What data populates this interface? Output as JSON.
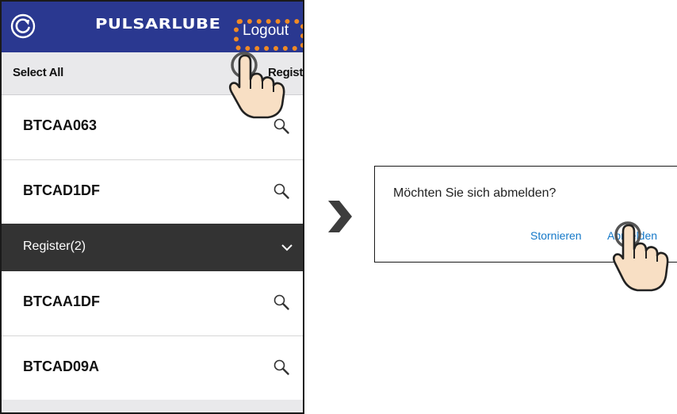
{
  "phone": {
    "header": {
      "logo_text": "PULSARLUBE",
      "logout_label": "Logout",
      "icons": {
        "refresh": "refresh-icon"
      },
      "colors": {
        "background": "#2a3890",
        "highlight": "#f08a24"
      }
    },
    "toolbar": {
      "select_all_label": "Select All",
      "register_label": "Register"
    },
    "devices": [
      {
        "id": "BTCAA063"
      },
      {
        "id": "BTCAD1DF"
      }
    ],
    "group": {
      "label": "Register(2)",
      "items": [
        {
          "id": "BTCAA1DF"
        },
        {
          "id": "BTCAD09A"
        }
      ]
    }
  },
  "dialog": {
    "message": "Möchten Sie sich abmelden?",
    "cancel_label": "Stornieren",
    "confirm_label": "Abmelden",
    "colors": {
      "button": "#1478c8"
    }
  },
  "icons": {
    "transition": "chevron-right-icon",
    "tap": "pointing-hand-icon",
    "search": "search-icon"
  }
}
